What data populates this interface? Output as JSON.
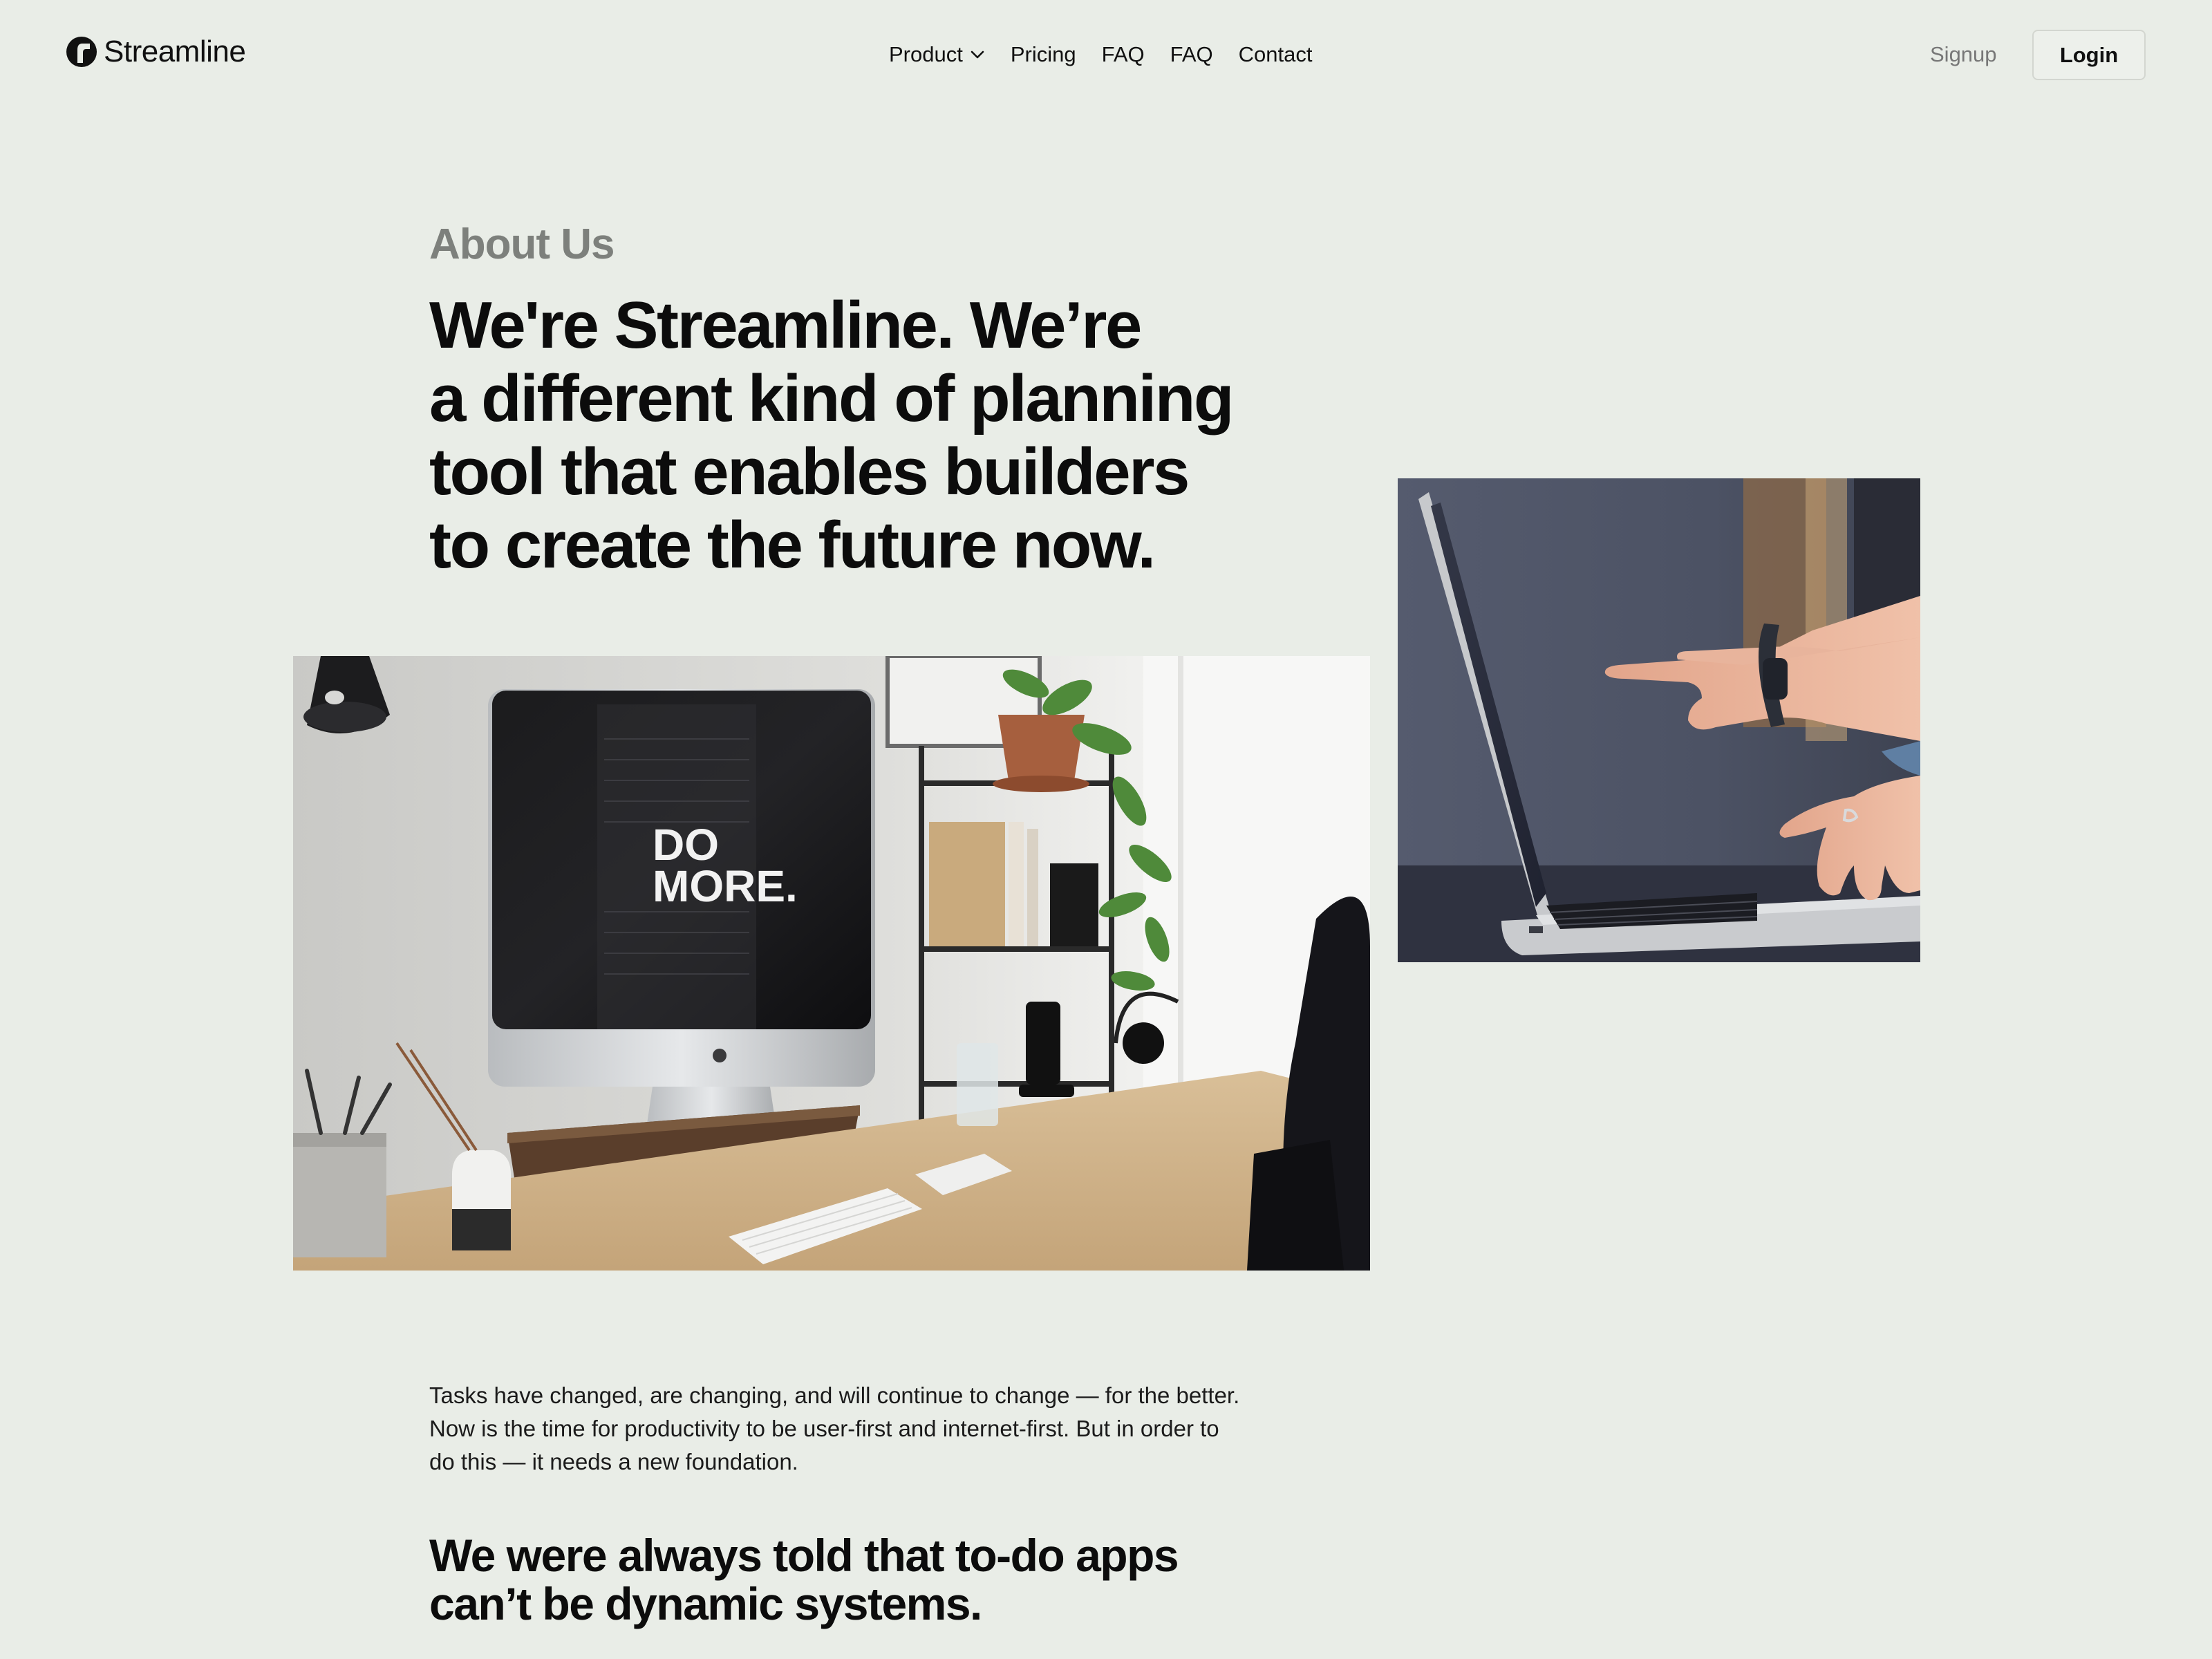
{
  "brand": {
    "name": "Streamline",
    "logo_icon": "streamline-logo-icon"
  },
  "nav": {
    "items": [
      {
        "label": "Product",
        "has_dropdown": true,
        "icon": "chevron-down-icon"
      },
      {
        "label": "Pricing"
      },
      {
        "label": "FAQ"
      },
      {
        "label": "FAQ"
      },
      {
        "label": "Contact"
      }
    ]
  },
  "auth": {
    "signup_label": "Signup",
    "login_label": "Login"
  },
  "hero": {
    "eyebrow": "About Us",
    "headline_lines": [
      "We're Streamline. We’re",
      "a different kind of planning",
      "tool that enables builders",
      "to create the future now."
    ]
  },
  "images": {
    "desk": {
      "screen_text_line1": "DO",
      "screen_text_line2": "MORE."
    },
    "laptop": {}
  },
  "body": {
    "paragraph": "Tasks have changed, are changing, and will continue to change — for the better. Now is the time for productivity to be user-first and internet-first. But in order to do this — it needs a new foundation.",
    "subheading_lines": [
      "We were always told that to-do apps",
      "can’t be dynamic systems."
    ]
  },
  "colors": {
    "background": "#e9ede7",
    "text": "#111111",
    "muted": "#7d807c",
    "button_border": "#d3d6d0"
  }
}
